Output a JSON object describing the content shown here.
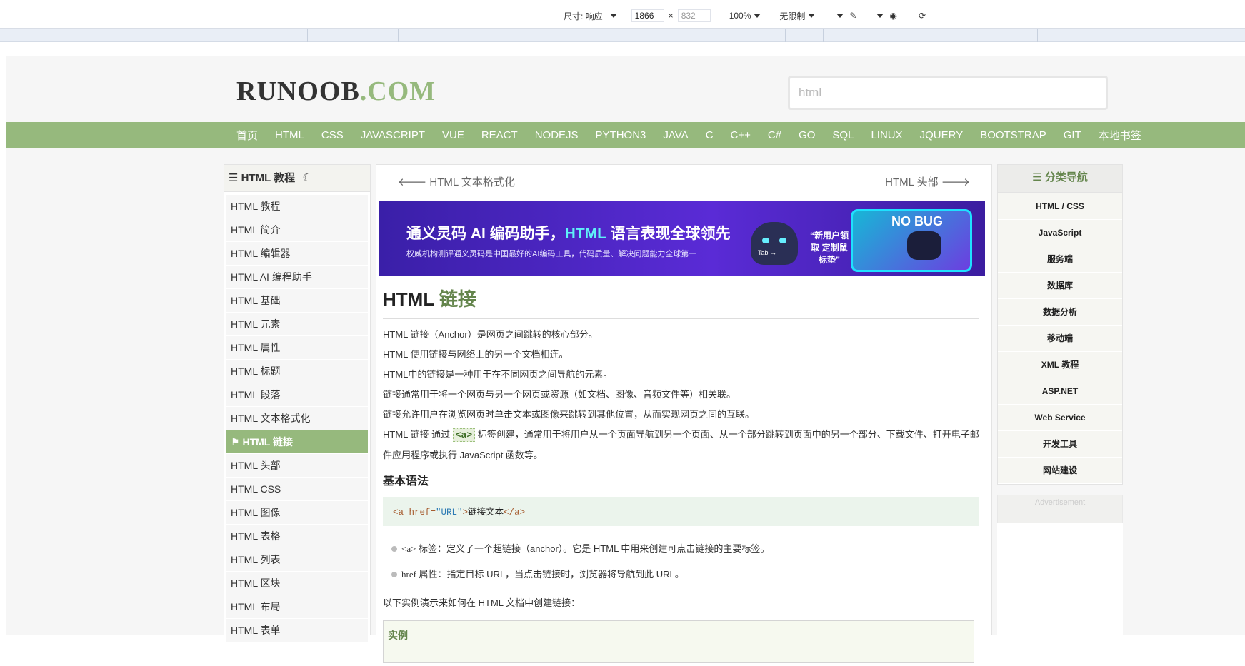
{
  "devtools": {
    "size_label": "尺寸: 响应",
    "width_value": "1866",
    "height_placeholder": "832",
    "zoom": "100%",
    "throttle": "无限制"
  },
  "site": {
    "logo_main": "RUNOOB",
    "logo_dot": ".COM",
    "search_placeholder": "html"
  },
  "nav": [
    "首页",
    "HTML",
    "CSS",
    "JAVASCRIPT",
    "VUE",
    "REACT",
    "NODEJS",
    "PYTHON3",
    "JAVA",
    "C",
    "C++",
    "C#",
    "GO",
    "SQL",
    "LINUX",
    "JQUERY",
    "BOOTSTRAP",
    "GIT",
    "本地书签"
  ],
  "left": {
    "title": "HTML 教程",
    "items": [
      "HTML 教程",
      "HTML 简介",
      "HTML 编辑器",
      "HTML AI 编程助手",
      "HTML 基础",
      "HTML 元素",
      "HTML 属性",
      "HTML 标题",
      "HTML 段落",
      "HTML 文本格式化",
      "HTML 链接",
      "HTML 头部",
      "HTML CSS",
      "HTML 图像",
      "HTML 表格",
      "HTML 列表",
      "HTML 区块",
      "HTML 布局",
      "HTML 表单"
    ],
    "active_index": 10
  },
  "main": {
    "prev": "HTML 文本格式化",
    "next": "HTML 头部",
    "banner_title_a": "通义灵码 AI 编码助手，",
    "banner_title_hl": "HTML",
    "banner_title_b": " 语言表现全球领先",
    "banner_sub": "权威机构测评通义灵码是中国最好的AI编码工具，代码质量、解决问题能力全球第一",
    "banner_bubble": "“新用户领取 定制鼠标垫”",
    "banner_badge": "NO BUG",
    "banner_tab": "Tab →",
    "h1_a": "HTML",
    "h1_b": " 链接",
    "paras": [
      "HTML 链接（Anchor）是网页之间跳转的核心部分。",
      "HTML 使用链接与网络上的另一个文档相连。",
      "HTML中的链接是一种用于在不同网页之间导航的元素。",
      "链接通常用于将一个网页与另一个网页或资源（如文档、图像、音频文件等）相关联。",
      "链接允许用户在浏览网页时单击文本或图像来跳转到其他位置，从而实现网页之间的互联。"
    ],
    "p6_a": "HTML 链接 通过 ",
    "p6_tag": "<a>",
    "p6_b": " 标签创建，通常用于将用户从一个页面导航到另一个页面、从一个部分跳转到页面中的另一个部分、下载文件、打开电子邮件应用程序或执行 JavaScript 函数等。",
    "h2": "基本语法",
    "code": {
      "open": "<a ",
      "attr": "href=",
      "val": "\"URL\"",
      "close": ">",
      "text": "链接文本",
      "end": "</a>"
    },
    "bullets": [
      {
        "mono": "<a>",
        "text": " 标签：定义了一个超链接（anchor）。它是 HTML 中用来创建可点击链接的主要标签。"
      },
      {
        "mono": "href",
        "text": " 属性：指定目标 URL，当点击链接时，浏览器将导航到此 URL。"
      }
    ],
    "lead": "以下实例演示来如何在 HTML 文档中创建链接：",
    "example": "实例"
  },
  "right": {
    "title": "分类导航",
    "items": [
      "HTML / CSS",
      "JavaScript",
      "服务端",
      "数据库",
      "数据分析",
      "移动端",
      "XML 教程",
      "ASP.NET",
      "Web Service",
      "开发工具",
      "网站建设"
    ],
    "ad": "Advertisement"
  }
}
